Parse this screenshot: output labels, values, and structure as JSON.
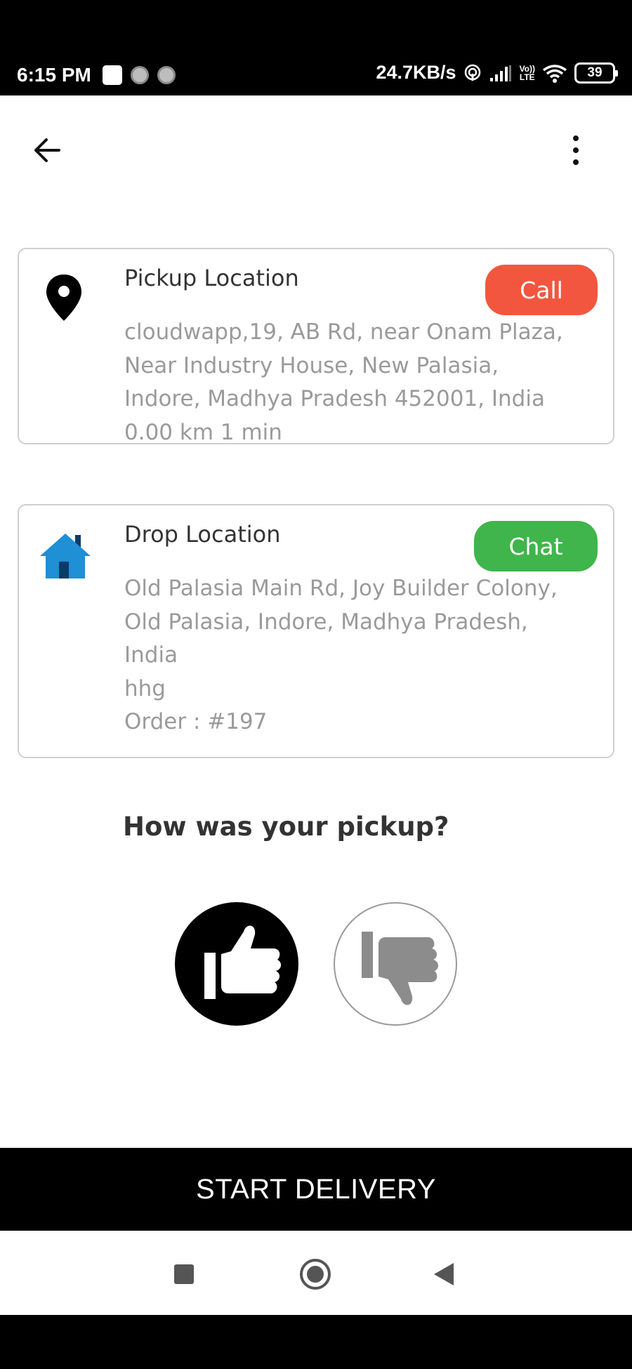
{
  "status_bar": {
    "time": "6:15 PM",
    "net_speed": "24.7KB/s",
    "volte_top": "Vo))",
    "volte_bottom": "LTE",
    "battery": "39"
  },
  "toolbar": {
    "back_icon": "arrow-left-icon",
    "menu_icon": "more-vertical-icon"
  },
  "pickup": {
    "icon": "map-pin-icon",
    "title": "Pickup Location",
    "action_label": "Call",
    "action_color": "#f2563f",
    "lines": [
      "cloudwapp,19, AB Rd, near Onam Plaza,",
      "Near Industry House, New Palasia,",
      "Indore, Madhya Pradesh 452001, India",
      "0.00 km  1 min"
    ]
  },
  "drop": {
    "icon": "house-icon",
    "title": "Drop Location",
    "action_label": "Chat",
    "action_color": "#3fb54b",
    "lines": [
      "Old Palasia Main Rd, Joy Builder Colony,",
      "Old Palasia, Indore, Madhya Pradesh,",
      "India",
      "hhg",
      "Order : #197"
    ]
  },
  "rating": {
    "question": "How was your pickup?",
    "thumbs_up_icon": "thumbs-up-icon",
    "thumbs_down_icon": "thumbs-down-icon",
    "selected": "thumbs-up"
  },
  "footer": {
    "start_label": "START DELIVERY"
  }
}
